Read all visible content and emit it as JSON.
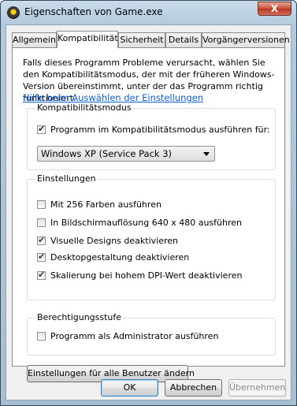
{
  "window": {
    "title": "Eigenschaften von Game.exe",
    "close_symbol": "X"
  },
  "tabs": [
    {
      "label": "Allgemein",
      "active": false
    },
    {
      "label": "Kompatibilität",
      "active": true
    },
    {
      "label": "Sicherheit",
      "active": false
    },
    {
      "label": "Details",
      "active": false
    },
    {
      "label": "Vorgängerversionen",
      "active": false
    }
  ],
  "panel": {
    "intro": "Falls dieses Programm Probleme verursacht, wählen Sie den Kompatibilitätsmodus, der mit der früheren Windows- Version übereinstimmt, unter der das Programm richtig funktioniert.",
    "help_link": "Hilfe beim Auswählen der Einstellungen"
  },
  "compat_mode": {
    "title": "Kompatibilitätsmodus",
    "checkbox_label": "Programm im Kompatibilitätsmodus ausführen für:",
    "checked": true,
    "selected_os": "Windows XP (Service Pack 3)"
  },
  "settings": {
    "title": "Einstellungen",
    "options": [
      {
        "label": "Mit 256 Farben ausführen",
        "checked": false
      },
      {
        "label": "In Bildschirmauflösung 640 x 480 ausführen",
        "checked": false
      },
      {
        "label": "Visuelle Designs deaktivieren",
        "checked": true
      },
      {
        "label": "Desktopgestaltung deaktivieren",
        "checked": true
      },
      {
        "label": "Skalierung bei hohem DPI-Wert deaktivieren",
        "checked": true
      }
    ]
  },
  "privilege": {
    "title": "Berechtigungsstufe",
    "checkbox_label": "Programm als Administrator ausführen",
    "checked": false
  },
  "all_users_button": "Einstellungen für alle Benutzer ändern",
  "buttons": {
    "ok": "OK",
    "cancel": "Abbrechen",
    "apply": "Übernehmen"
  }
}
